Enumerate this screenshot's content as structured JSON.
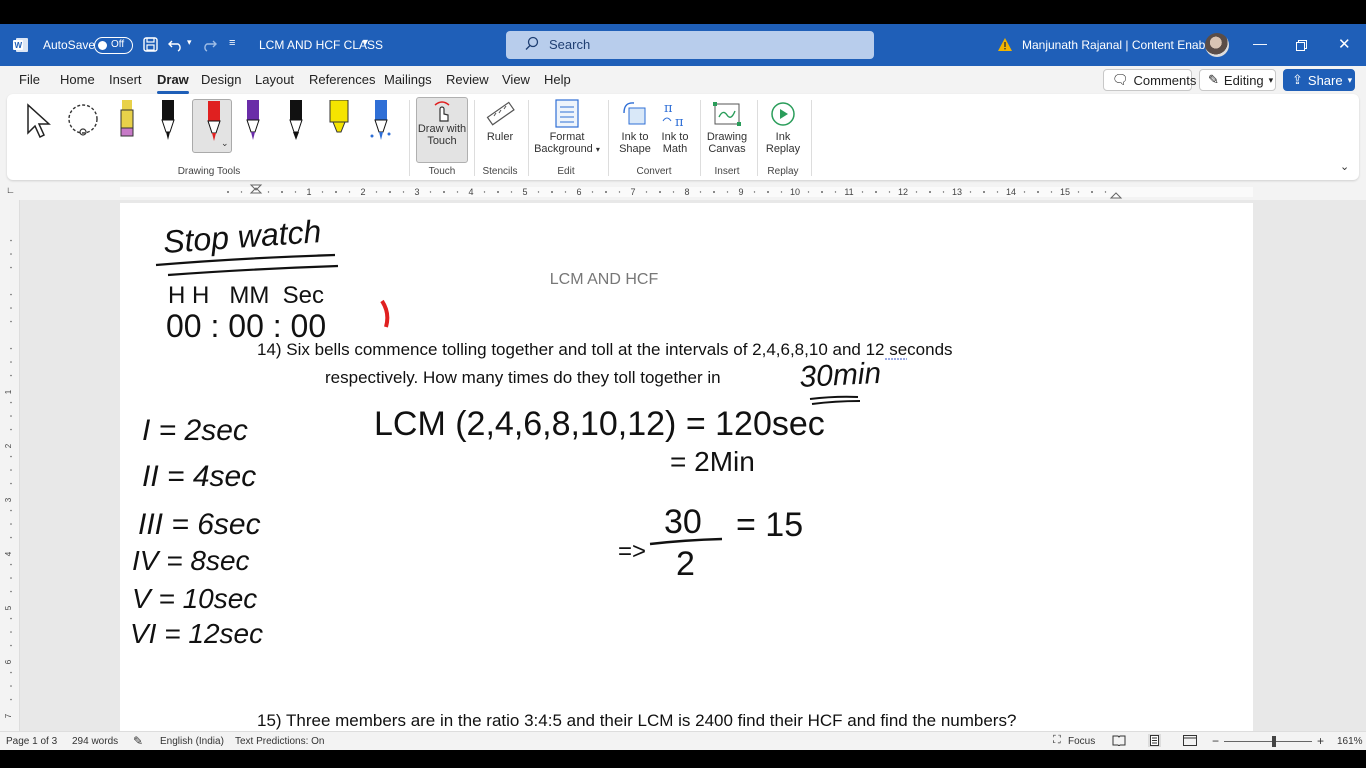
{
  "titlebar": {
    "autosave_label": "AutoSave",
    "autosave_state": "Off",
    "doc_title": "LCM AND HCF CLASS",
    "search_placeholder": "Search",
    "user_name": "Manjunath Rajanal | Content Enablers"
  },
  "menu": {
    "items": [
      "File",
      "Home",
      "Insert",
      "Draw",
      "Design",
      "Layout",
      "References",
      "Mailings",
      "Review",
      "View",
      "Help"
    ],
    "active": "Draw",
    "comments_label": "Comments",
    "editing_label": "Editing",
    "share_label": "Share"
  },
  "ribbon": {
    "drawing_tools_label": "Drawing Tools",
    "draw_with_touch": [
      "Draw with",
      "Touch"
    ],
    "touch_group": "Touch",
    "ruler_label": "Ruler",
    "stencils_group": "Stencils",
    "format_background": [
      "Format",
      "Background"
    ],
    "edit_group": "Edit",
    "ink_to_shape": [
      "Ink to",
      "Shape"
    ],
    "ink_to_math": [
      "Ink to",
      "Math"
    ],
    "convert_group": "Convert",
    "drawing_canvas": [
      "Drawing",
      "Canvas"
    ],
    "insert_group": "Insert",
    "ink_replay": [
      "Ink",
      "Replay"
    ],
    "replay_group": "Replay",
    "pen_colors": [
      "#e8d14a",
      "#111111",
      "#e02020",
      "#6a2da8",
      "#111111",
      "#f5e400",
      "#2f6fd6"
    ]
  },
  "ruler": {
    "numbers": [
      "1",
      "2",
      "3",
      "4",
      "5",
      "6",
      "7",
      "8",
      "9",
      "10",
      "11",
      "12",
      "13",
      "14",
      "15"
    ],
    "vnumbers": [
      "1",
      "2",
      "3",
      "4",
      "5",
      "6",
      "7"
    ]
  },
  "document": {
    "heading": "LCM AND HCF",
    "q14_line1": "14) Six bells commence tolling together and toll at the intervals of 2,4,6,8,10 and 12   seconds",
    "q14_line2": "respectively. How many times do they toll together in",
    "q15": "15) Three members are in the ratio 3:4:5 and their LCM is 2400 find their HCF and find the numbers?"
  },
  "ink": {
    "stopwatch": "Stop watch",
    "time_headers": "H H   MM  Sec",
    "time_value": "00 : 00 : 00",
    "answer_time": "30min",
    "bells": [
      "I = 2sec",
      "II = 4sec",
      "III = 6sec",
      "IV = 8sec",
      "V = 10sec",
      "VI = 12sec"
    ],
    "lcm_line": "LCM (2,4,6,8,10,12) = 120sec",
    "min_line": "= 2Min",
    "fraction_num": "30",
    "fraction_den": "2",
    "fraction_result": "= 15",
    "arrow": "=>"
  },
  "status": {
    "page": "Page 1 of 3",
    "words": "294 words",
    "language": "English (India)",
    "predictions": "Text Predictions: On",
    "focus": "Focus",
    "zoom": "161%"
  }
}
